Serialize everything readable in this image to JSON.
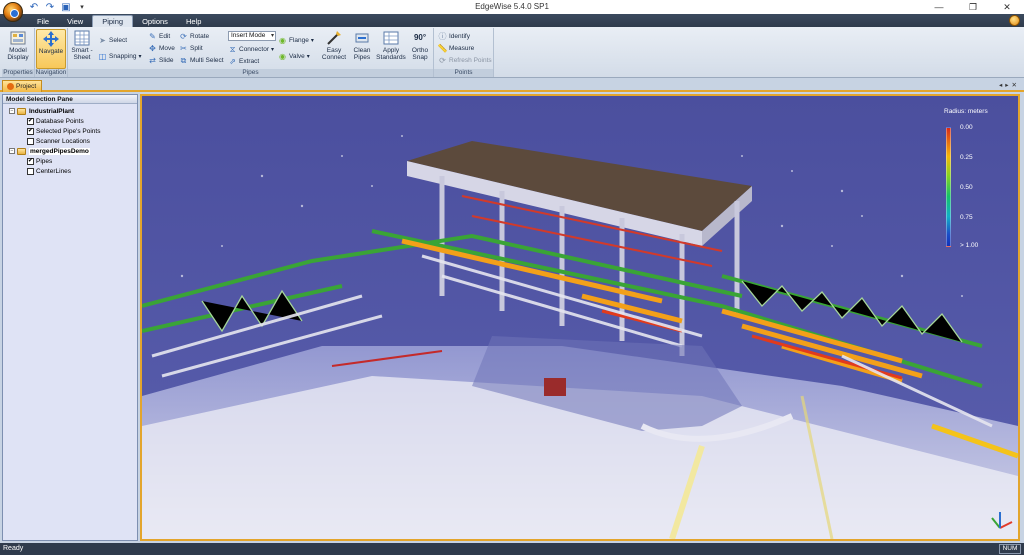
{
  "window": {
    "title": "EdgeWise 5.4.0 SP1"
  },
  "menu": {
    "tabs": [
      "File",
      "View",
      "Piping",
      "Options",
      "Help"
    ],
    "active": "Piping"
  },
  "ribbon": {
    "properties": {
      "model_display": "Model Display",
      "label": "Properties"
    },
    "navigation": {
      "navigate": "Navgate",
      "label": "Navigation"
    },
    "pipes": {
      "smart_sheet": "Smart - Sheet",
      "select": "Select",
      "snapping": "Snapping",
      "edit": "Edit",
      "move": "Move",
      "slide": "Slide",
      "rotate": "Rotate",
      "split": "Split",
      "multi_select": "Multi Select",
      "mode": "Insert Mode",
      "connector": "Connector",
      "extract": "Extract",
      "flange": "Flange",
      "valve": "Valve",
      "easy_connect": "Easy Connect",
      "clean_pipes": "Clean Pipes",
      "apply_standards": "Apply Standards",
      "ortho_snap": "Ortho Snap",
      "ortho_icon_text": "90°",
      "label": "Pipes"
    },
    "points": {
      "identify": "Identify",
      "measure": "Measure",
      "refresh_points": "Refresh Points",
      "label": "Points"
    }
  },
  "doc_tab": {
    "label": "Project"
  },
  "pane": {
    "title": "Model Selection Pane",
    "tree": [
      {
        "label": "IndustrialPlant",
        "children": [
          {
            "label": "Database Points",
            "checked": true
          },
          {
            "label": "Selected Pipe's Points",
            "checked": true
          },
          {
            "label": "Scanner Locations",
            "checked": false
          }
        ]
      },
      {
        "label": "mergedPipesDemo",
        "children": [
          {
            "label": "Pipes",
            "checked": true
          },
          {
            "label": "CenterLines",
            "checked": false
          }
        ]
      }
    ]
  },
  "legend": {
    "title": "Radius: meters",
    "ticks": [
      "0.00",
      "0.25",
      "0.50",
      "0.75",
      "> 1.00"
    ],
    "colors": [
      "#d92a18",
      "#f6b70a",
      "#8ad320",
      "#14c26a",
      "#11b0c8",
      "#1232b8"
    ]
  },
  "status": {
    "text": "Ready",
    "num": "NUM"
  },
  "icons": {
    "check": "✔"
  }
}
